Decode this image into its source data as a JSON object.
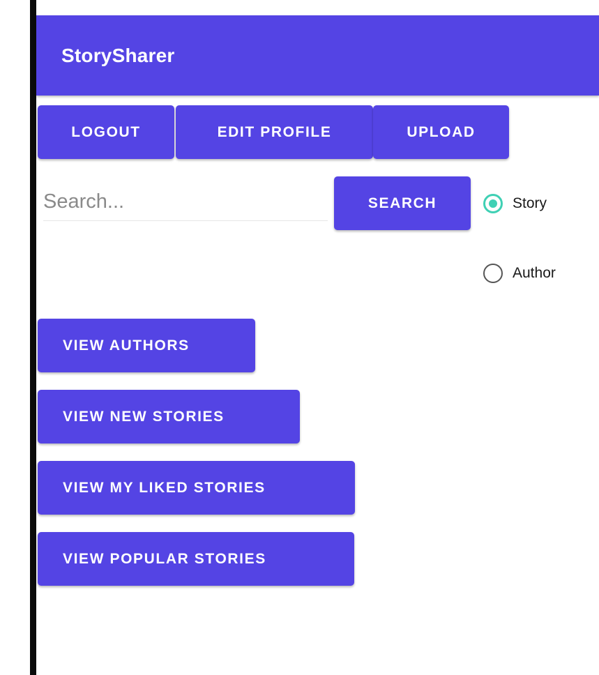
{
  "app_bar": {
    "title": "StorySharer",
    "color": "#5444e4"
  },
  "toolbar": {
    "logout_label": "LOGOUT",
    "edit_profile_label": "EDIT PROFILE",
    "upload_label": "UPLOAD"
  },
  "search": {
    "placeholder": "Search...",
    "value": "",
    "button_label": "SEARCH"
  },
  "search_type": {
    "selected": "Story",
    "options": [
      "Story",
      "Author"
    ],
    "accent_color": "#3fd0b4"
  },
  "nav_buttons": {
    "authors": "VIEW AUTHORS",
    "new_stories": "VIEW NEW STORIES",
    "liked_stories": "VIEW MY LIKED STORIES",
    "popular_stories": "VIEW POPULAR STORIES"
  }
}
